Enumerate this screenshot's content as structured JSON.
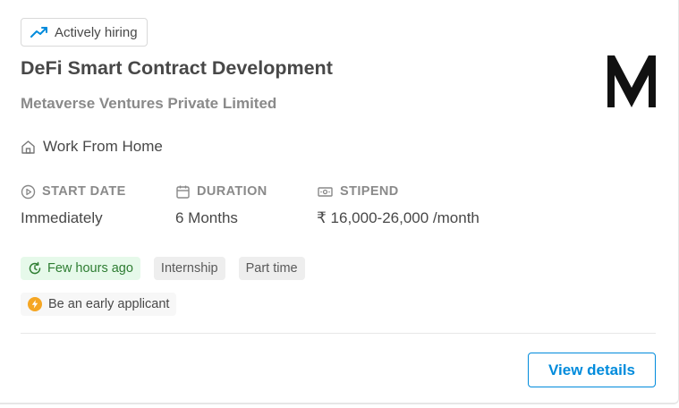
{
  "badge": {
    "label": "Actively hiring",
    "icon": "trending-up-icon",
    "color": "#008bdc"
  },
  "job": {
    "title": "DeFi Smart Contract Development",
    "company": "Metaverse Ventures Private Limited",
    "logo": "company-logo-m"
  },
  "location": {
    "label": "Work From Home",
    "icon": "home-icon"
  },
  "details": {
    "start_date": {
      "label": "START DATE",
      "value": "Immediately",
      "icon": "play-circle-icon"
    },
    "duration": {
      "label": "DURATION",
      "value": "6 Months",
      "icon": "calendar-icon"
    },
    "stipend": {
      "label": "STIPEND",
      "value": "₹ 16,000-26,000 /month",
      "icon": "money-icon"
    }
  },
  "tags": {
    "posted": "Few hours ago",
    "type": "Internship",
    "schedule": "Part time"
  },
  "early_applicant": {
    "label": "Be an early applicant",
    "icon": "bolt-icon",
    "color": "#f5a623"
  },
  "actions": {
    "view_details": "View details"
  },
  "colors": {
    "accent": "#008bdc",
    "success": "#2e7d32",
    "success_bg": "#e6f9ea"
  }
}
